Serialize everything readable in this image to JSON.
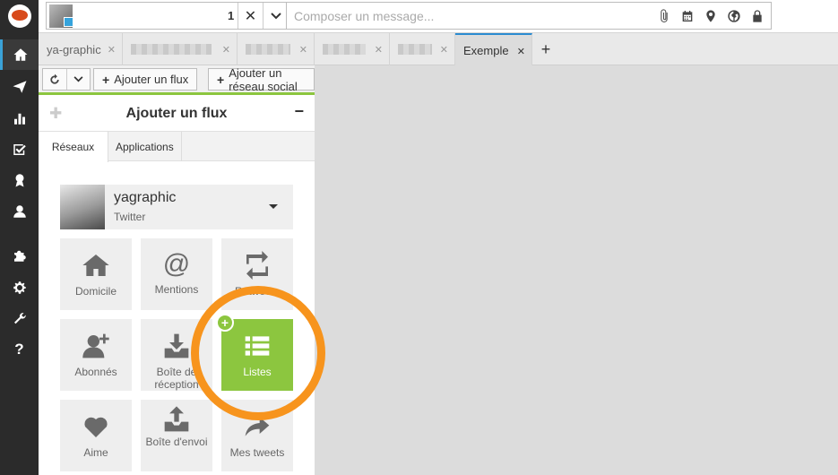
{
  "top": {
    "profile_count": "1",
    "compose_placeholder": "Composer un message..."
  },
  "tabs": [
    {
      "label": "ya-graphic"
    },
    {
      "label": ""
    },
    {
      "label": ""
    },
    {
      "label": ""
    },
    {
      "label": ""
    },
    {
      "label": "Exemple"
    }
  ],
  "toolbar": {
    "add_stream_label": "Ajouter un flux",
    "add_network_label": "Ajouter un réseau social"
  },
  "panel": {
    "title": "Ajouter un flux",
    "subtabs": [
      "Réseaux",
      "Applications"
    ],
    "account": {
      "name": "yagraphic",
      "network": "Twitter"
    },
    "tiles": [
      {
        "label": "Domicile",
        "icon": "home-icon"
      },
      {
        "label": "Mentions",
        "icon": "at-icon"
      },
      {
        "label": "Retweets",
        "icon": "retweet-icon"
      },
      {
        "label": "Abonnés",
        "icon": "add-user-icon"
      },
      {
        "label": "Boîte de réception",
        "icon": "inbox-download-icon"
      },
      {
        "label": "Listes",
        "icon": "list-icon"
      },
      {
        "label": "Aime",
        "icon": "heart-icon"
      },
      {
        "label": "Boîte d'envoi",
        "icon": "outbox-upload-icon"
      },
      {
        "label": "Mes tweets",
        "icon": "share-arrow-icon"
      }
    ]
  },
  "colors": {
    "sidebar_bg": "#2b2b2b",
    "accent_green": "#8cc63f",
    "highlight_orange": "#f7941d",
    "active_blue": "#2b8bd1"
  }
}
